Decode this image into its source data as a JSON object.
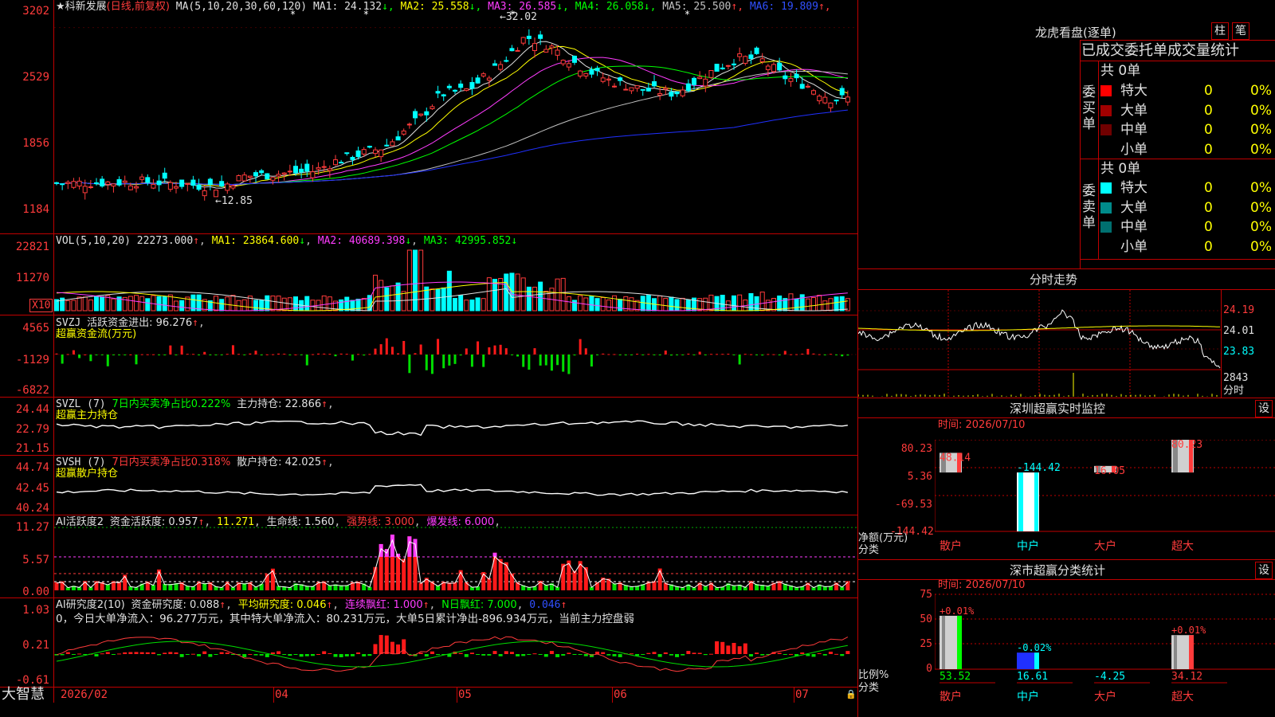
{
  "stock": {
    "name": "★科新发展",
    "mode": "(日线,前复权)"
  },
  "ma_header": {
    "params": "MA(5,10,20,30,60,120)",
    "items": [
      {
        "label": "MA1:",
        "value": "24.132",
        "arrow": "↓",
        "color": "#e0e0e0"
      },
      {
        "label": "MA2:",
        "value": "25.558",
        "arrow": "↓",
        "color": "#ffff00"
      },
      {
        "label": "MA3:",
        "value": "26.585",
        "arrow": "↓",
        "color": "#ff3cff"
      },
      {
        "label": "MA4:",
        "value": "26.058",
        "arrow": "↓",
        "color": "#00ff00"
      },
      {
        "label": "MA5:",
        "value": "25.500",
        "arrow": "↑",
        "color": "#c0c0c0"
      },
      {
        "label": "MA6:",
        "value": "19.809",
        "arrow": "↑",
        "color": "#3050ff"
      }
    ]
  },
  "price_axis": [
    "3202",
    "2529",
    "1856",
    "1184"
  ],
  "price_notes": {
    "high": "32.02",
    "low": "12.85"
  },
  "vol_header": {
    "params": "VOL(5,10,20)",
    "value": "22273.000",
    "arrow": "↑",
    "ma1": "MA1: 23864.600",
    "ma1_arrow": "↓",
    "ma2": "MA2: 40689.398",
    "ma2_arrow": "↓",
    "ma3": "MA3: 42995.852",
    "ma3_arrow": "↓"
  },
  "vol_axis": [
    "22821",
    "11270"
  ],
  "vol_unit": "X10",
  "svzj": {
    "name": "SVZJ",
    "label": "活跃资金进出: 96.276",
    "arrow": "↑",
    "sub": "超赢资金流(万元)",
    "axis": [
      "4565",
      "-1129",
      "-6822"
    ]
  },
  "svzl": {
    "name": "SVZL (7)",
    "ratio": "7日内买卖净占比0.222%",
    "label": "主力持仓: 22.866",
    "arrow": "↑",
    "sub": "超赢主力持仓",
    "axis": [
      "24.44",
      "22.79",
      "21.15"
    ]
  },
  "svsh": {
    "name": "SVSH (7)",
    "ratio": "7日内买卖净占比0.318%",
    "label": "散户持仓: 42.025",
    "arrow": "↑",
    "sub": "超赢散户持仓",
    "axis": [
      "44.74",
      "42.45",
      "40.24"
    ]
  },
  "ai1": {
    "name": "AI活跃度2",
    "a": "资金活跃度: 0.957",
    "a_arrow": "↑",
    "b": "11.271",
    "c": "生命线: 1.560",
    "d": "强势线: 3.000",
    "e": "爆发线: 6.000",
    "axis": [
      "11.27",
      "5.57",
      "0.00"
    ]
  },
  "ai2": {
    "name": "AI研究度2(10)",
    "a": "资金研究度: 0.088",
    "a_arrow": "↑",
    "b": "平均研究度: 0.046",
    "b_arrow": "↑",
    "c": "连续飘红: 1.000",
    "c_arrow": "↑",
    "d": "N日飘红: 7.000",
    "e": "0.046",
    "e_arrow": "↑",
    "line2": "0，今日大单净流入：96.277万元，其中特大单净流入：80.231万元，大单5日累计净出-896.934万元，当前主力控盘弱",
    "axis": [
      "1.03",
      "0.21",
      "-0.61"
    ]
  },
  "date_axis": [
    "2026/02",
    "04",
    "05",
    "06",
    "07"
  ],
  "brand": "大智慧",
  "lhb": {
    "title": "龙虎看盘(逐单)",
    "btn1": "柱",
    "btn2": "笔",
    "tabs": "已成交委托单成交量统计",
    "buy_side": "委买单",
    "sell_side": "委卖单",
    "buy_total": "共 0单",
    "sell_total": "共 0单",
    "buy_rows": [
      {
        "label": "特大",
        "value": "0",
        "pct": "0%",
        "color": "#ff0000"
      },
      {
        "label": "大单",
        "value": "0",
        "pct": "0%",
        "color": "#a00000"
      },
      {
        "label": "中单",
        "value": "0",
        "pct": "0%",
        "color": "#700000"
      },
      {
        "label": "小单",
        "value": "0",
        "pct": "0%",
        "color": "#000000"
      }
    ],
    "sell_rows": [
      {
        "label": "特大",
        "value": "0",
        "pct": "0%",
        "color": "#00ffff"
      },
      {
        "label": "大单",
        "value": "0",
        "pct": "0%",
        "color": "#008b8b"
      },
      {
        "label": "中单",
        "value": "0",
        "pct": "0%",
        "color": "#007070"
      },
      {
        "label": "小单",
        "value": "0",
        "pct": "0%",
        "color": "#000000"
      }
    ]
  },
  "intraday": {
    "title": "分时走势",
    "axis": [
      "24.19",
      "24.01",
      "23.83"
    ],
    "vol": "2843",
    "unit": "分时"
  },
  "monitor": {
    "title": "深圳超赢实时监控",
    "btn": "设",
    "time": "时间: 2026/07/10",
    "axis": [
      "80.23",
      "5.36",
      "-69.53",
      "-144.42"
    ],
    "ylabel1": "净额(万元)",
    "ylabel2": "分类",
    "bars": [
      {
        "cat": "散户",
        "value": "48.14"
      },
      {
        "cat": "中户",
        "value": "-144.42"
      },
      {
        "cat": "大户",
        "value": "16.05"
      },
      {
        "cat": "超大",
        "value": "80.23"
      }
    ]
  },
  "classify": {
    "title": "深市超赢分类统计",
    "btn": "设",
    "time": "时间: 2026/07/10",
    "axis": [
      "75",
      "50",
      "25",
      "0"
    ],
    "ylabel1": "比例%",
    "ylabel2": "分类",
    "bars": [
      {
        "cat": "散户",
        "top": "+0.01%",
        "value": "53.52"
      },
      {
        "cat": "中户",
        "top": "-0.02%",
        "value": "16.61"
      },
      {
        "cat": "大户",
        "top": "",
        "value": "-4.25"
      },
      {
        "cat": "超大",
        "top": "+0.01%",
        "value": "34.12"
      }
    ]
  }
}
